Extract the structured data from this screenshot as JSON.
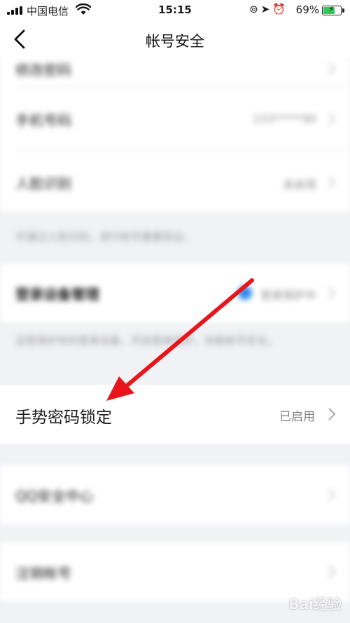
{
  "status_bar": {
    "carrier": "中国电信",
    "time": "15:15",
    "battery": "69%",
    "battery_level": 0.69,
    "icons": [
      "rotation-lock-icon",
      "location-icon",
      "alarm-icon"
    ]
  },
  "nav": {
    "title": "帐号安全",
    "back_icon": "chevron-left-icon"
  },
  "blurred_rows": [
    {
      "label": "修改密码",
      "value": ""
    },
    {
      "label": "手机号码",
      "value": "133*****90"
    },
    {
      "label": "人脸识别",
      "value": "未启用"
    }
  ],
  "hint_face": "可通过人脸识别，进行帐号重要验证。",
  "device_row": {
    "label": "登录设备管理",
    "value": "登录保护中"
  },
  "hint_device": "这是保护你的登录设备，开启登录保护，你能帐号安全。",
  "gesture_row": {
    "label": "手势密码锁定",
    "value": "已启用"
  },
  "bottom_rows": [
    {
      "label": "QQ安全中心"
    },
    {
      "label": "注销帐号"
    }
  ],
  "watermark": "Bai经验",
  "colors": {
    "accent": "#2d8cf0",
    "arrow": "#e8161b",
    "background": "#f1f2f6"
  }
}
